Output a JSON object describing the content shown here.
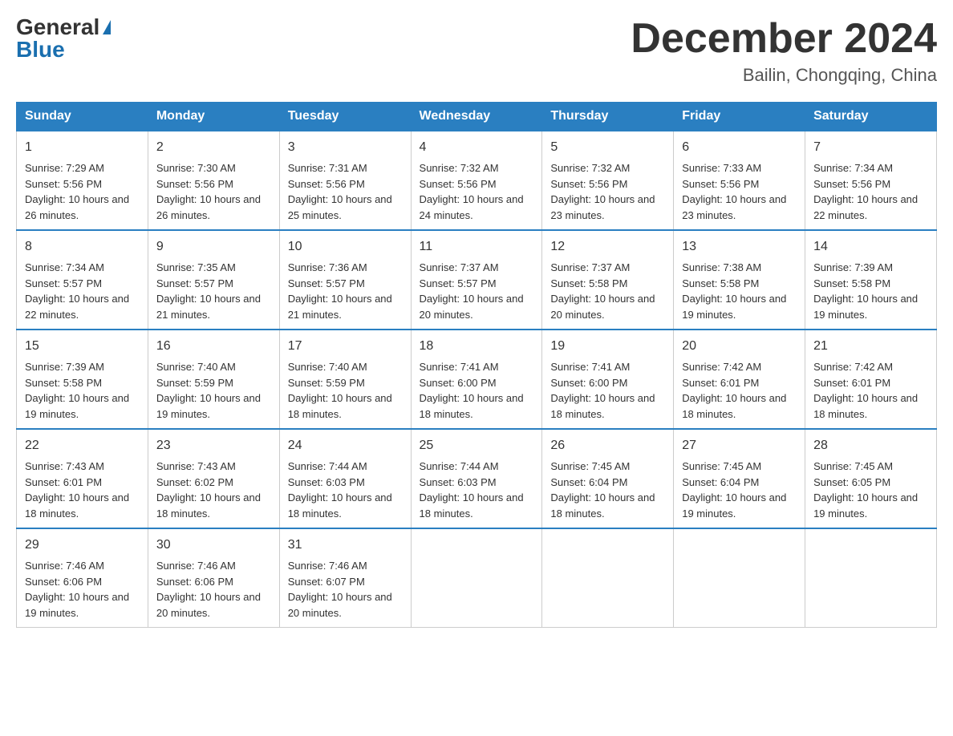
{
  "logo": {
    "general": "General",
    "blue": "Blue"
  },
  "header": {
    "month_year": "December 2024",
    "location": "Bailin, Chongqing, China"
  },
  "days_of_week": [
    "Sunday",
    "Monday",
    "Tuesday",
    "Wednesday",
    "Thursday",
    "Friday",
    "Saturday"
  ],
  "weeks": [
    [
      {
        "day": "1",
        "sunrise": "7:29 AM",
        "sunset": "5:56 PM",
        "daylight": "10 hours and 26 minutes."
      },
      {
        "day": "2",
        "sunrise": "7:30 AM",
        "sunset": "5:56 PM",
        "daylight": "10 hours and 26 minutes."
      },
      {
        "day": "3",
        "sunrise": "7:31 AM",
        "sunset": "5:56 PM",
        "daylight": "10 hours and 25 minutes."
      },
      {
        "day": "4",
        "sunrise": "7:32 AM",
        "sunset": "5:56 PM",
        "daylight": "10 hours and 24 minutes."
      },
      {
        "day": "5",
        "sunrise": "7:32 AM",
        "sunset": "5:56 PM",
        "daylight": "10 hours and 23 minutes."
      },
      {
        "day": "6",
        "sunrise": "7:33 AM",
        "sunset": "5:56 PM",
        "daylight": "10 hours and 23 minutes."
      },
      {
        "day": "7",
        "sunrise": "7:34 AM",
        "sunset": "5:56 PM",
        "daylight": "10 hours and 22 minutes."
      }
    ],
    [
      {
        "day": "8",
        "sunrise": "7:34 AM",
        "sunset": "5:57 PM",
        "daylight": "10 hours and 22 minutes."
      },
      {
        "day": "9",
        "sunrise": "7:35 AM",
        "sunset": "5:57 PM",
        "daylight": "10 hours and 21 minutes."
      },
      {
        "day": "10",
        "sunrise": "7:36 AM",
        "sunset": "5:57 PM",
        "daylight": "10 hours and 21 minutes."
      },
      {
        "day": "11",
        "sunrise": "7:37 AM",
        "sunset": "5:57 PM",
        "daylight": "10 hours and 20 minutes."
      },
      {
        "day": "12",
        "sunrise": "7:37 AM",
        "sunset": "5:58 PM",
        "daylight": "10 hours and 20 minutes."
      },
      {
        "day": "13",
        "sunrise": "7:38 AM",
        "sunset": "5:58 PM",
        "daylight": "10 hours and 19 minutes."
      },
      {
        "day": "14",
        "sunrise": "7:39 AM",
        "sunset": "5:58 PM",
        "daylight": "10 hours and 19 minutes."
      }
    ],
    [
      {
        "day": "15",
        "sunrise": "7:39 AM",
        "sunset": "5:58 PM",
        "daylight": "10 hours and 19 minutes."
      },
      {
        "day": "16",
        "sunrise": "7:40 AM",
        "sunset": "5:59 PM",
        "daylight": "10 hours and 19 minutes."
      },
      {
        "day": "17",
        "sunrise": "7:40 AM",
        "sunset": "5:59 PM",
        "daylight": "10 hours and 18 minutes."
      },
      {
        "day": "18",
        "sunrise": "7:41 AM",
        "sunset": "6:00 PM",
        "daylight": "10 hours and 18 minutes."
      },
      {
        "day": "19",
        "sunrise": "7:41 AM",
        "sunset": "6:00 PM",
        "daylight": "10 hours and 18 minutes."
      },
      {
        "day": "20",
        "sunrise": "7:42 AM",
        "sunset": "6:01 PM",
        "daylight": "10 hours and 18 minutes."
      },
      {
        "day": "21",
        "sunrise": "7:42 AM",
        "sunset": "6:01 PM",
        "daylight": "10 hours and 18 minutes."
      }
    ],
    [
      {
        "day": "22",
        "sunrise": "7:43 AM",
        "sunset": "6:01 PM",
        "daylight": "10 hours and 18 minutes."
      },
      {
        "day": "23",
        "sunrise": "7:43 AM",
        "sunset": "6:02 PM",
        "daylight": "10 hours and 18 minutes."
      },
      {
        "day": "24",
        "sunrise": "7:44 AM",
        "sunset": "6:03 PM",
        "daylight": "10 hours and 18 minutes."
      },
      {
        "day": "25",
        "sunrise": "7:44 AM",
        "sunset": "6:03 PM",
        "daylight": "10 hours and 18 minutes."
      },
      {
        "day": "26",
        "sunrise": "7:45 AM",
        "sunset": "6:04 PM",
        "daylight": "10 hours and 18 minutes."
      },
      {
        "day": "27",
        "sunrise": "7:45 AM",
        "sunset": "6:04 PM",
        "daylight": "10 hours and 19 minutes."
      },
      {
        "day": "28",
        "sunrise": "7:45 AM",
        "sunset": "6:05 PM",
        "daylight": "10 hours and 19 minutes."
      }
    ],
    [
      {
        "day": "29",
        "sunrise": "7:46 AM",
        "sunset": "6:06 PM",
        "daylight": "10 hours and 19 minutes."
      },
      {
        "day": "30",
        "sunrise": "7:46 AM",
        "sunset": "6:06 PM",
        "daylight": "10 hours and 20 minutes."
      },
      {
        "day": "31",
        "sunrise": "7:46 AM",
        "sunset": "6:07 PM",
        "daylight": "10 hours and 20 minutes."
      },
      null,
      null,
      null,
      null
    ]
  ]
}
